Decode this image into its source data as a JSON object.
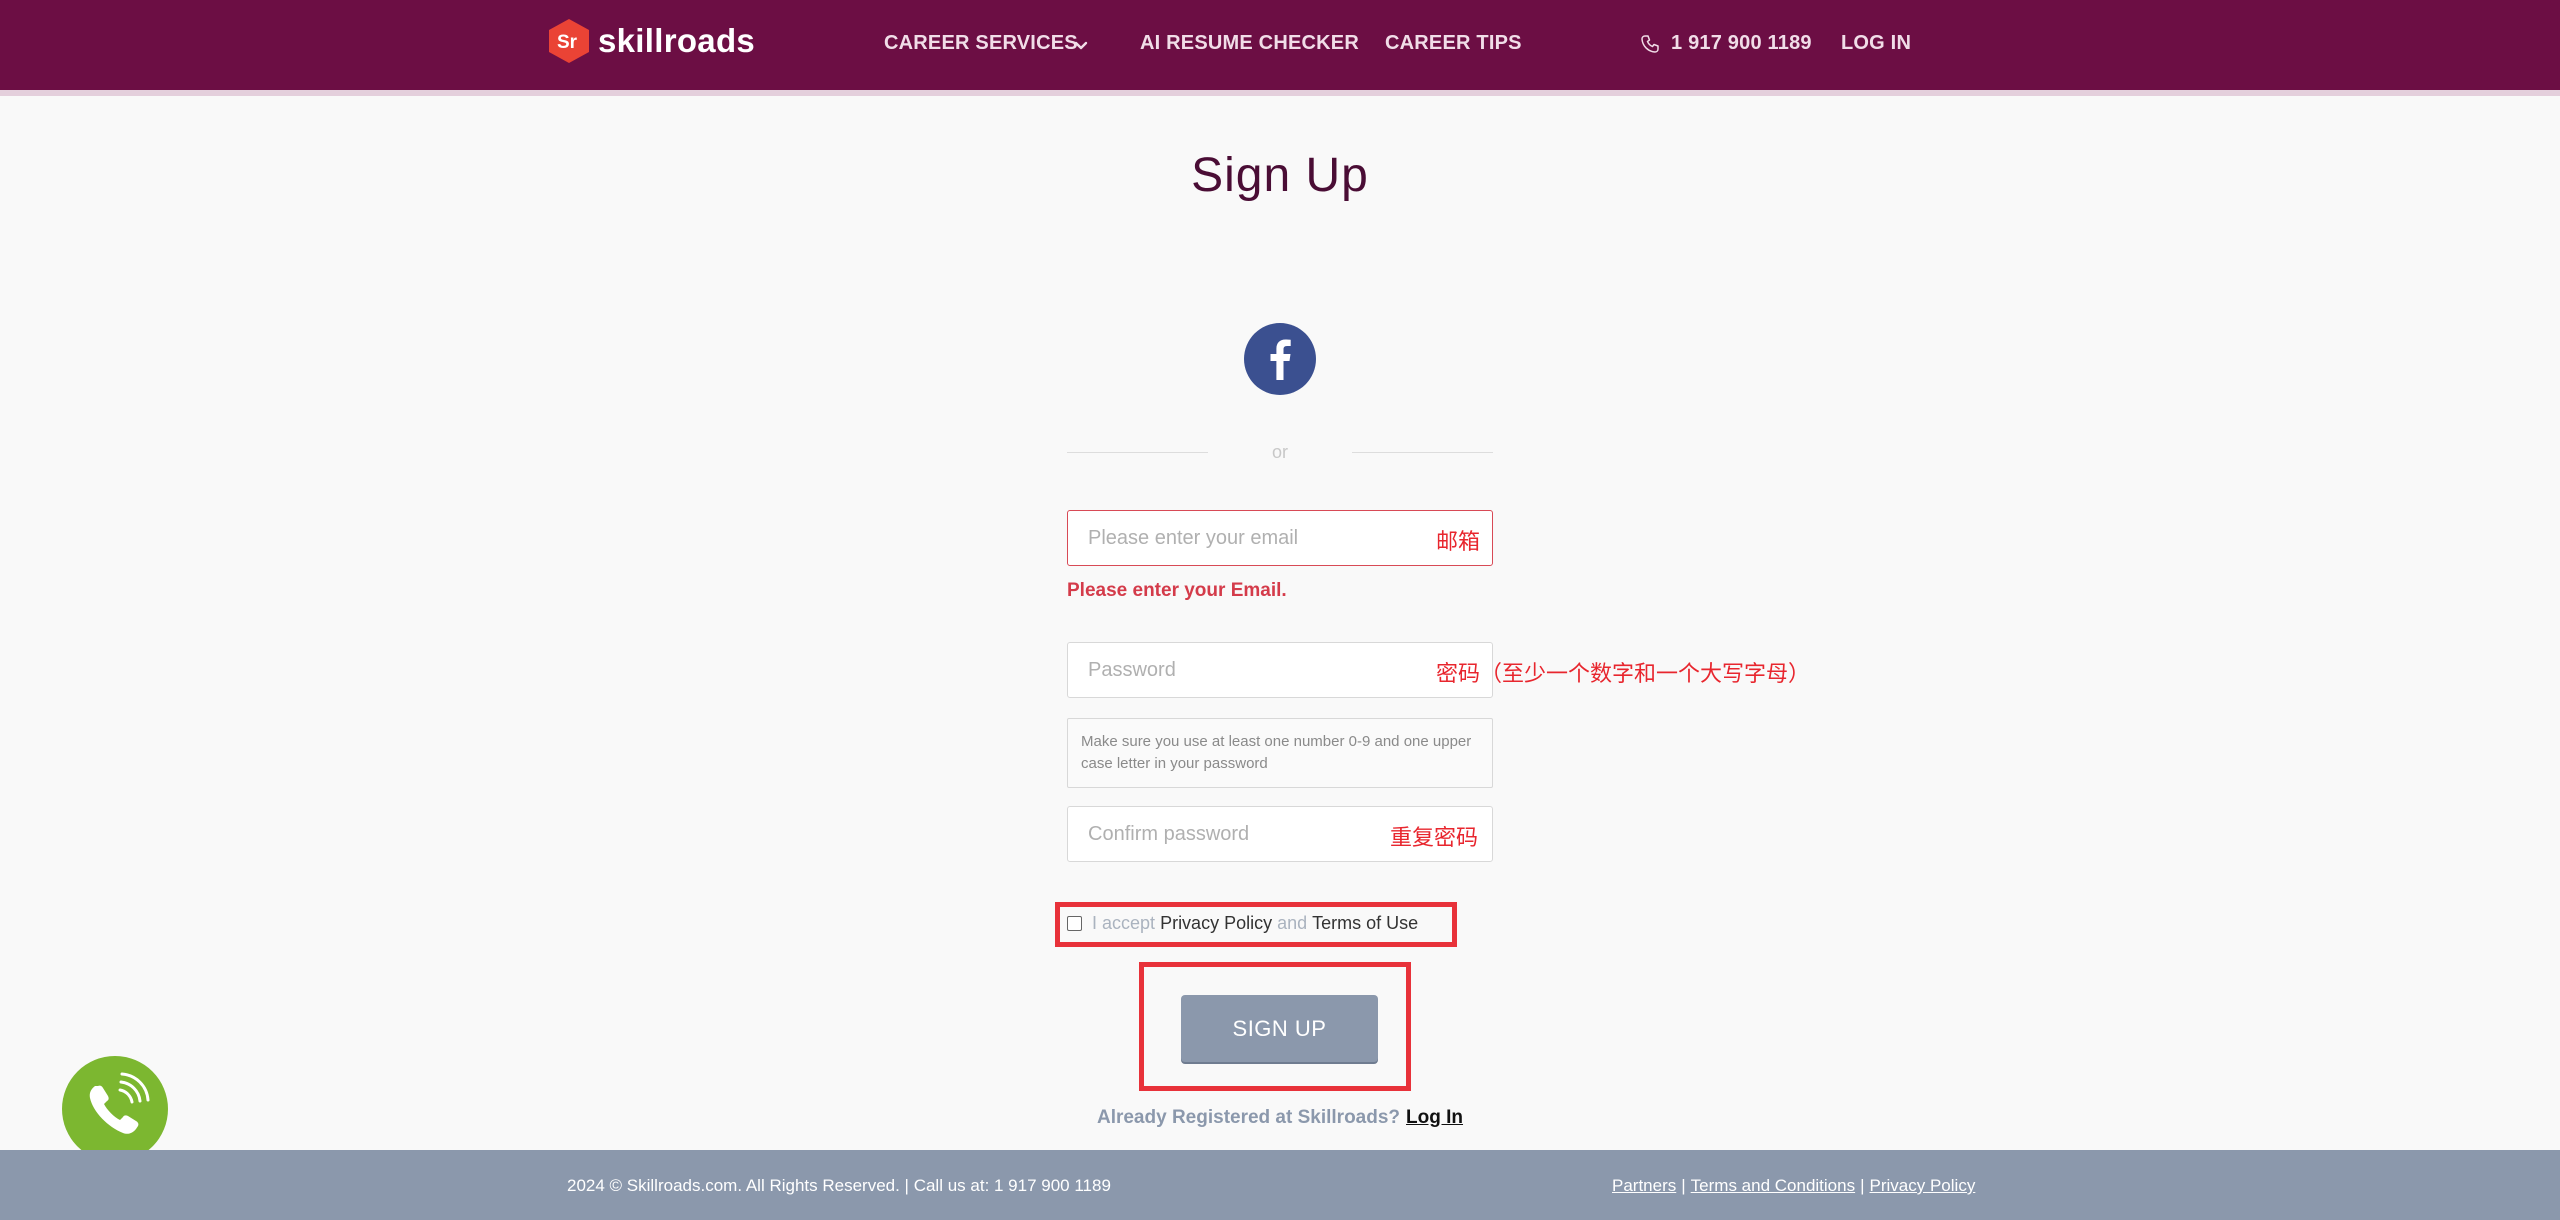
{
  "brand": {
    "name": "skillroads",
    "logo_letters": "Sr",
    "primary_color": "#6c0e44",
    "logo_color": "#ea4335"
  },
  "nav": {
    "career_services": "CAREER SERVICES",
    "resume_checker": "AI RESUME CHECKER",
    "career_tips": "CAREER TIPS",
    "phone": "1 917 900 1189",
    "login": "LOG IN"
  },
  "main": {
    "title": "Sign Up",
    "or_text": "or",
    "email": {
      "placeholder": "Please enter your email",
      "annotation": "邮箱",
      "error": "Please enter your Email."
    },
    "password": {
      "placeholder": "Password",
      "annotation": "密码（至少一个数字和一个大写字母）",
      "hint": "Make sure you use at least one number 0-9 and one upper case letter in your password"
    },
    "confirm_password": {
      "placeholder": "Confirm password",
      "annotation": "重复密码"
    },
    "accept": {
      "prefix": "I accept",
      "privacy": "Privacy Policy",
      "and": "and",
      "terms": "Terms of Use"
    },
    "signup_label": "SIGN UP",
    "already_text": "Already Registered at Skillroads?",
    "login_link": "Log In"
  },
  "footer": {
    "copyright": "2024 © Skillroads.com. All Rights Reserved. | Call us at: 1 917 900 1189",
    "links": [
      "Partners",
      "Terms and Conditions",
      "Privacy Policy"
    ],
    "separator": "|"
  },
  "icons": {
    "facebook": "facebook-icon",
    "phone": "phone-icon",
    "chevron": "chevron-down-icon",
    "call_widget": "call-widget-icon"
  },
  "colors": {
    "annotation_red": "#e8262e",
    "button_gray": "#8b98ac",
    "facebook_blue": "#3b5090",
    "call_green": "#7cb730"
  }
}
